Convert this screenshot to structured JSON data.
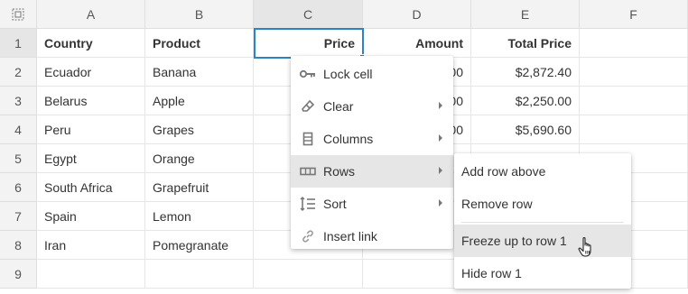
{
  "columns": [
    "A",
    "B",
    "C",
    "D",
    "E",
    "F"
  ],
  "rows": [
    "1",
    "2",
    "3",
    "4",
    "5",
    "6",
    "7",
    "8",
    "9"
  ],
  "header_row": {
    "A": "Country",
    "B": "Product",
    "C": "Price",
    "D": "Amount",
    "E": "Total Price"
  },
  "data_rows": [
    {
      "A": "Ecuador",
      "B": "Banana",
      "D": "00",
      "E": "$2,872.40"
    },
    {
      "A": "Belarus",
      "B": "Apple",
      "D": "00",
      "E": "$2,250.00"
    },
    {
      "A": "Peru",
      "B": "Grapes",
      "D": "00",
      "E": "$5,690.60"
    },
    {
      "A": "Egypt",
      "B": "Orange"
    },
    {
      "A": "South Africa",
      "B": "Grapefruit"
    },
    {
      "A": "Spain",
      "B": "Lemon"
    },
    {
      "A": "Iran",
      "B": "Pomegranate"
    },
    {}
  ],
  "context_menu": {
    "items": [
      {
        "label": "Lock cell",
        "icon": "key-icon"
      },
      {
        "label": "Clear",
        "icon": "eraser-icon"
      },
      {
        "label": "Columns",
        "icon": "columns-icon"
      },
      {
        "label": "Rows",
        "icon": "rows-icon"
      },
      {
        "label": "Sort",
        "icon": "sort-icon"
      },
      {
        "label": "Insert link",
        "icon": "link-icon"
      }
    ]
  },
  "rows_submenu": {
    "items": [
      {
        "label": "Add row above"
      },
      {
        "label": "Remove row"
      },
      {
        "label": "Freeze up to row 1"
      },
      {
        "label": "Hide row 1"
      }
    ]
  },
  "colors": {
    "accent": "#2b84c6",
    "header_bg": "#f3f3f3",
    "hover_bg": "#e6e6e6"
  }
}
